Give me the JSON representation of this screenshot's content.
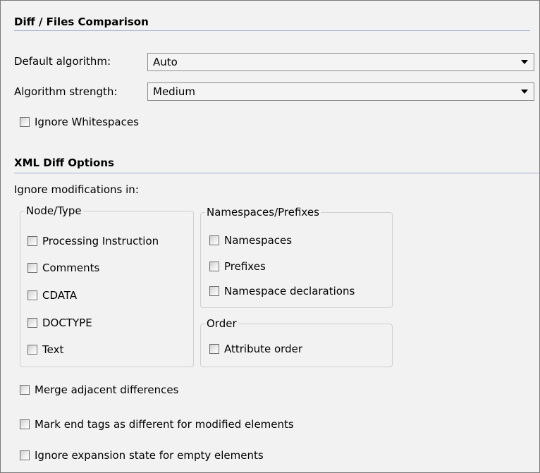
{
  "diff_section": {
    "title": "Diff / Files Comparison",
    "default_algorithm_label": "Default algorithm:",
    "default_algorithm_value": "Auto",
    "algorithm_strength_label": "Algorithm strength:",
    "algorithm_strength_value": "Medium",
    "ignore_whitespaces": {
      "label": "Ignore Whitespaces",
      "checked": false
    }
  },
  "xml_section": {
    "title": "XML Diff Options",
    "ignore_modifications_label": "Ignore modifications in:",
    "node_type_group": {
      "legend": "Node/Type",
      "items": [
        {
          "label": "Processing Instruction",
          "checked": false
        },
        {
          "label": "Comments",
          "checked": false
        },
        {
          "label": "CDATA",
          "checked": false
        },
        {
          "label": "DOCTYPE",
          "checked": false
        },
        {
          "label": "Text",
          "checked": false
        }
      ]
    },
    "namespaces_group": {
      "legend": "Namespaces/Prefixes",
      "items": [
        {
          "label": "Namespaces",
          "checked": false
        },
        {
          "label": "Prefixes",
          "checked": false
        },
        {
          "label": "Namespace declarations",
          "checked": false
        }
      ]
    },
    "order_group": {
      "legend": "Order",
      "items": [
        {
          "label": "Attribute order",
          "checked": false
        }
      ]
    },
    "merge_adjacent": {
      "label": "Merge adjacent differences",
      "checked": false
    },
    "mark_end_tags": {
      "label": "Mark end tags as different for modified elements",
      "checked": false
    },
    "ignore_expansion": {
      "label": "Ignore expansion state for empty elements",
      "checked": false
    }
  }
}
